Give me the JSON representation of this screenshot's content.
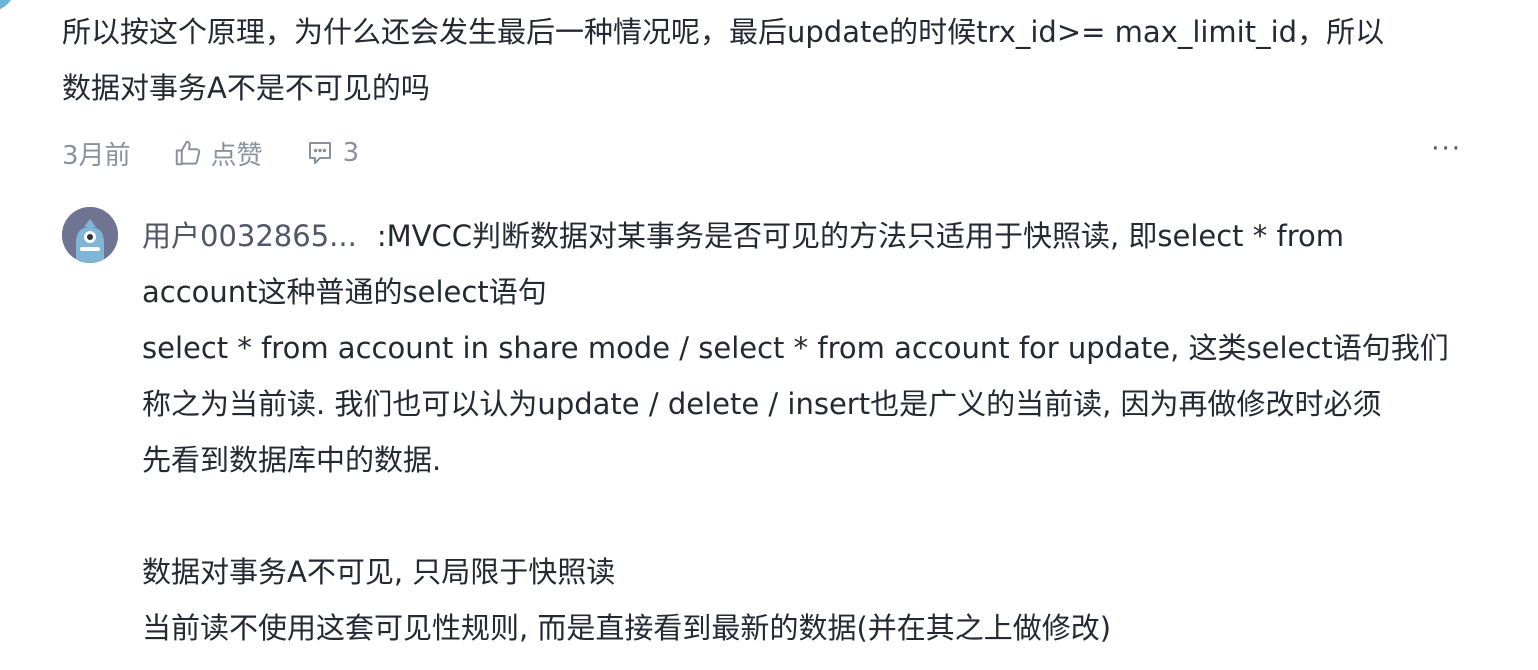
{
  "comment": {
    "line1": "所以按这个原理，为什么还会发生最后一种情况呢，最后update的时候trx_id>= max_limit_id，所以",
    "line2": "数据对事务A不是不可见的吗",
    "time": "3月前",
    "like_label": "点赞",
    "reply_count": "3",
    "more": "···"
  },
  "reply": {
    "author": "用户0032865...",
    "lines": [
      ":MVCC判断数据对某事务是否可见的方法只适用于快照读, 即select * from",
      "account这种普通的select语句",
      "select * from account in share mode / select * from account for update, 这类select语句我们",
      "称之为当前读. 我们也可以认为update / delete / insert也是广义的当前读, 因为再做修改时必须",
      "先看到数据库中的数据.",
      "数据对事务A不可见, 只局限于快照读",
      "当前读不使用这套可见性规则, 而是直接看到最新的数据(并在其之上做修改)"
    ]
  },
  "icons": {
    "like": "thumbs-up-icon",
    "comment": "comment-bubble-icon",
    "more": "more-dots-icon",
    "avatar": "robot-avatar-icon"
  },
  "colors": {
    "text": "#252933",
    "muted": "#8a919f",
    "avatar_bg": "#6e7492",
    "corner_avatar": "#6cb4d8"
  }
}
